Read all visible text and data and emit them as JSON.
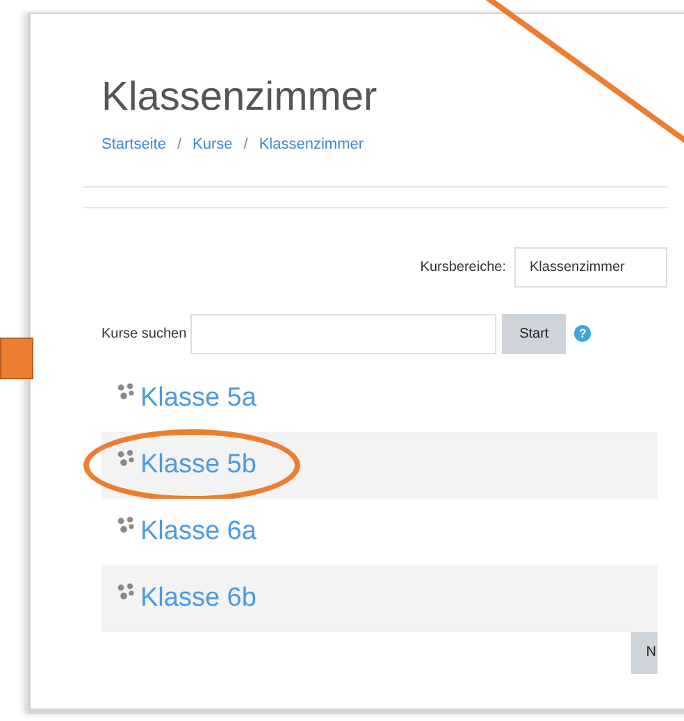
{
  "page": {
    "title": "Klassenzimmer",
    "breadcrumb": [
      "Startseite",
      "Kurse",
      "Klassenzimmer"
    ],
    "breadcrumb_separator": "/"
  },
  "category": {
    "label": "Kursbereiche:",
    "value": "Klassenzimmer"
  },
  "search": {
    "label": "Kurse suchen",
    "button": "Start",
    "help_icon": "?"
  },
  "courses": [
    {
      "name": "Klasse 5a",
      "circled": false
    },
    {
      "name": "Klasse 5b",
      "circled": true
    },
    {
      "name": "Klasse 6a",
      "circled": false
    },
    {
      "name": "Klasse 6b",
      "circled": false
    }
  ],
  "next_button": "N",
  "line_annotation": true,
  "square_annotation": true
}
